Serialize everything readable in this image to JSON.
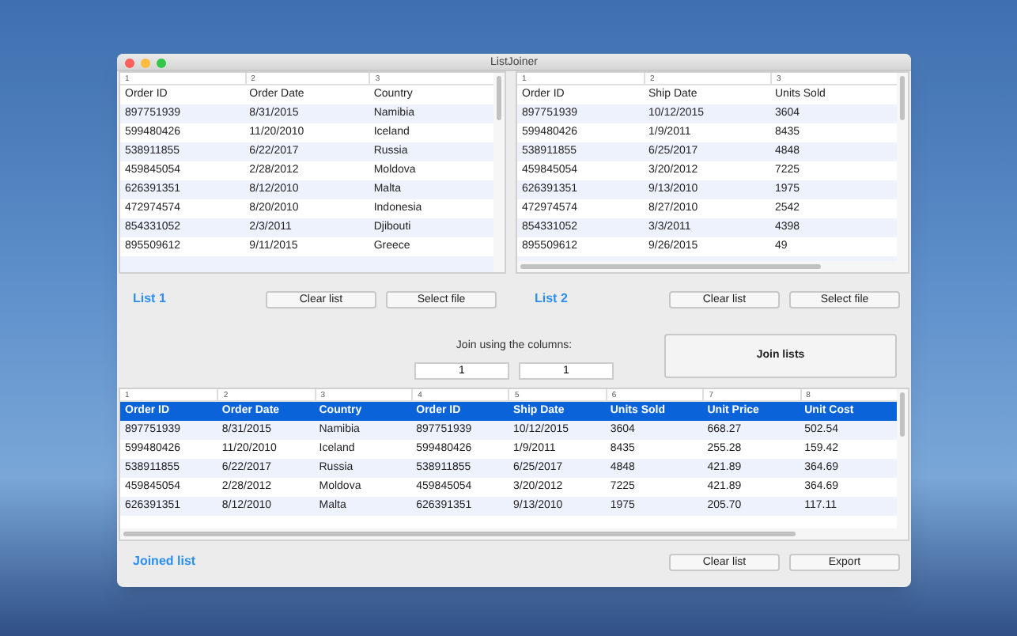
{
  "window": {
    "title": "ListJoiner"
  },
  "list_1": {
    "columns": [
      "1",
      "2",
      "3"
    ],
    "rows": [
      [
        "Order ID",
        "Order Date",
        "Country"
      ],
      [
        "897751939",
        "8/31/2015",
        "Namibia"
      ],
      [
        "599480426",
        "11/20/2010",
        "Iceland"
      ],
      [
        "538911855",
        "6/22/2017",
        "Russia"
      ],
      [
        "459845054",
        "2/28/2012",
        "Moldova"
      ],
      [
        "626391351",
        "8/12/2010",
        "Malta"
      ],
      [
        "472974574",
        "8/20/2010",
        "Indonesia"
      ],
      [
        "854331052",
        "2/3/2011",
        "Djibouti"
      ],
      [
        "895509612",
        "9/11/2015",
        "Greece"
      ]
    ],
    "label": "List 1",
    "buttons": [
      "Clear list",
      "Select file"
    ]
  },
  "list_2": {
    "columns": [
      "1",
      "2",
      "3"
    ],
    "rows": [
      [
        "Order ID",
        "Ship Date",
        "Units Sold"
      ],
      [
        "897751939",
        "10/12/2015",
        "3604"
      ],
      [
        "599480426",
        "1/9/2011",
        "8435"
      ],
      [
        "538911855",
        "6/25/2017",
        "4848"
      ],
      [
        "459845054",
        "3/20/2012",
        "7225"
      ],
      [
        "626391351",
        "9/13/2010",
        "1975"
      ],
      [
        "472974574",
        "8/27/2010",
        "2542"
      ],
      [
        "854331052",
        "3/3/2011",
        "4398"
      ],
      [
        "895509612",
        "9/26/2015",
        "49"
      ]
    ],
    "label": "List 2",
    "buttons": [
      "Clear list",
      "Select file"
    ]
  },
  "join": {
    "label": "Join using the columns:",
    "column_1": "1",
    "column_2": "1",
    "button": "Join lists"
  },
  "joined_list": {
    "columns": [
      "1",
      "2",
      "3",
      "4",
      "5",
      "6",
      "7",
      "8"
    ],
    "rows": [
      {
        "cells": [
          "Order ID",
          "Order Date",
          "Country",
          "Order ID",
          "Ship Date",
          "Units Sold",
          "Unit Price",
          "Unit Cost"
        ],
        "selected": true
      },
      {
        "cells": [
          "897751939",
          "8/31/2015",
          "Namibia",
          "897751939",
          "10/12/2015",
          "3604",
          "668.27",
          "502.54"
        ],
        "selected": false
      },
      {
        "cells": [
          "599480426",
          "11/20/2010",
          "Iceland",
          "599480426",
          "1/9/2011",
          "8435",
          "255.28",
          "159.42"
        ],
        "selected": false
      },
      {
        "cells": [
          "538911855",
          "6/22/2017",
          "Russia",
          "538911855",
          "6/25/2017",
          "4848",
          "421.89",
          "364.69"
        ],
        "selected": false
      },
      {
        "cells": [
          "459845054",
          "2/28/2012",
          "Moldova",
          "459845054",
          "3/20/2012",
          "7225",
          "421.89",
          "364.69"
        ],
        "selected": false
      },
      {
        "cells": [
          "626391351",
          "8/12/2010",
          "Malta",
          "626391351",
          "9/13/2010",
          "1975",
          "205.70",
          "117.11"
        ],
        "selected": false
      }
    ],
    "label": "Joined list",
    "buttons": [
      "Clear list",
      "Export"
    ]
  }
}
